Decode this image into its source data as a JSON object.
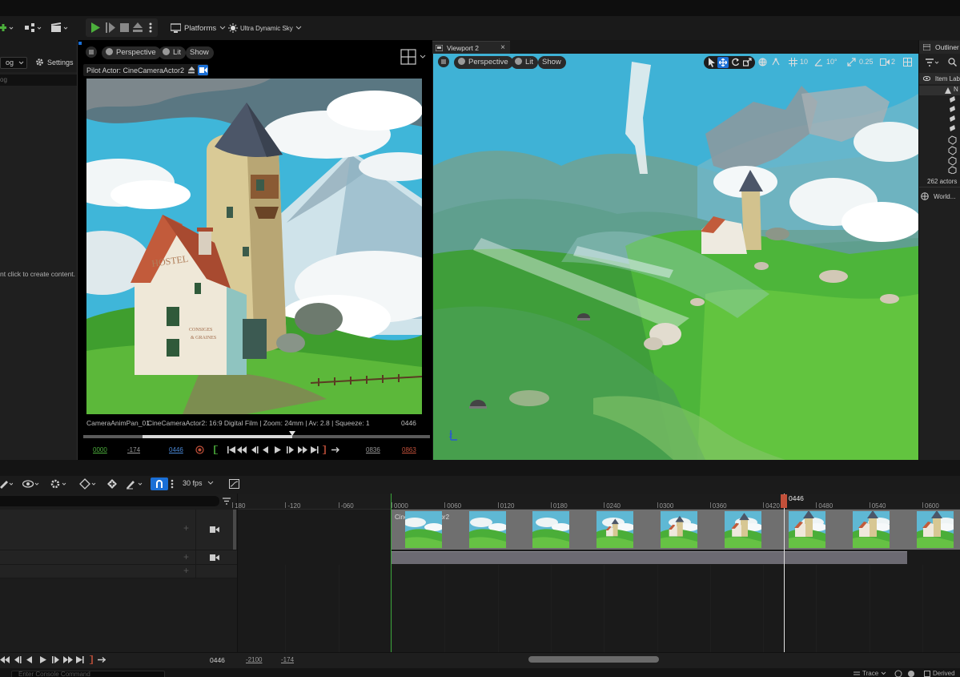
{
  "toolbar": {
    "platforms_label": "Platforms",
    "sky_label": "Ultra Dynamic Sky"
  },
  "left_panel": {
    "dropdown_value": "og",
    "settings_label": "Settings",
    "search_fragment": "og",
    "hint_text": "nt click to create content."
  },
  "viewport1": {
    "perspective_label": "Perspective",
    "lit_label": "Lit",
    "show_label": "Show",
    "pilot_label": "Pilot Actor: CineCameraActor2",
    "overlay_left": "CameraAnimPan_01",
    "overlay_info": "CineCameraActor2: 16:9 Digital Film | Zoom: 24mm | Av: 2.8 | Squeeze: 1",
    "overlay_frame": "0446",
    "tc_start": "0000",
    "tc_neg": "-174",
    "tc_current": "0446",
    "tc_end": "0836",
    "tc_red": "0863"
  },
  "viewport2": {
    "tab_label": "Viewport 2",
    "tab_close": "×",
    "perspective_label": "Perspective",
    "lit_label": "Lit",
    "show_label": "Show",
    "grid_value": "10",
    "angle_value": "10°",
    "scale_value": "0.25",
    "camera_speed": "2"
  },
  "outliner": {
    "title": "Outliner",
    "column_label": "Item Lab",
    "first_item": "N",
    "actor_count": "262 actors",
    "world_label": "World..."
  },
  "sequencer": {
    "fps_label": "30 fps",
    "current_frame_label": "0446",
    "ruler_labels": [
      "180",
      "-120",
      "-060",
      "0000",
      "0060",
      "0120",
      "0180",
      "0240",
      "0300",
      "0360",
      "0420",
      "0480",
      "0540",
      "0600"
    ],
    "clip_label": "CineCameraActor2",
    "bottom_frame": "0446",
    "bottom_start": "-2100",
    "bottom_neg": "-174"
  },
  "console": {
    "placeholder": "Enter Console Command",
    "trace_label": "Trace",
    "derived_label": "Derived"
  },
  "colors": {
    "accent": "#1a6fd6",
    "play_green": "#4caf3c",
    "playhead": "#c2503a",
    "sky": "#3fb6d9"
  }
}
